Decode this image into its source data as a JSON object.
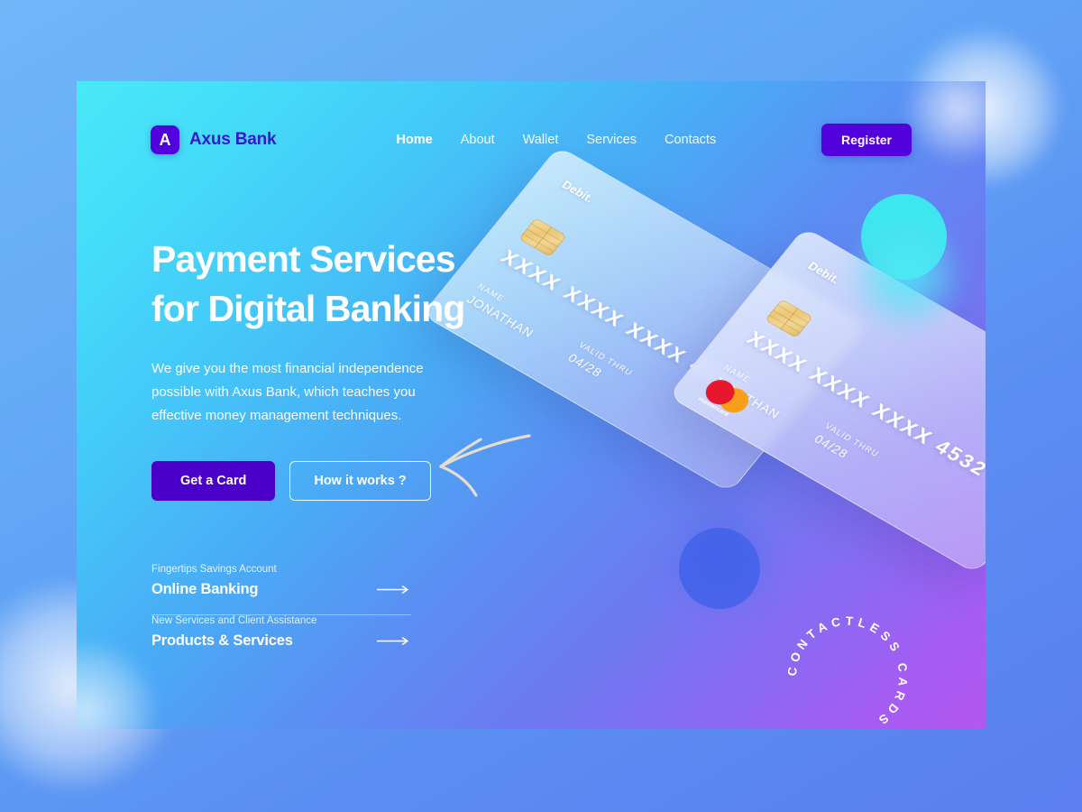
{
  "brand": {
    "logo_letter": "A",
    "name": "Axus Bank",
    "logo_color": "#5200dc",
    "name_color": "#3618cf"
  },
  "nav": {
    "items": [
      {
        "label": "Home",
        "active": true
      },
      {
        "label": "About",
        "active": false
      },
      {
        "label": "Wallet",
        "active": false
      },
      {
        "label": "Services",
        "active": false
      },
      {
        "label": "Contacts",
        "active": false
      }
    ],
    "register_label": "Register"
  },
  "hero": {
    "heading_line1": "Payment Services",
    "heading_line2": "for Digital Banking",
    "paragraph": "We give you the most financial independence possible with Axus Bank, which teaches you effective money management techniques.",
    "primary_cta": "Get a Card",
    "secondary_cta": "How it works ?"
  },
  "links": [
    {
      "kicker": "Fingertips Savings Account",
      "title": "Online Banking"
    },
    {
      "kicker": "New Services and Client Assistance",
      "title": "Products & Services"
    }
  ],
  "cards": [
    {
      "type_label": "Debit.",
      "number": "XXXX XXXX XXXX 4532",
      "name_label": "NAME",
      "name_value": "JONATHAN",
      "valid_label": "VALID THRU",
      "valid_value": "04/28",
      "network": ""
    },
    {
      "type_label": "Debit.",
      "number": "XXXX XXXX XXXX 4532",
      "name_label": "NAME",
      "name_value": "JONATHAN",
      "valid_label": "VALID THRU",
      "valid_value": "04/28",
      "network": "mastercard"
    }
  ],
  "badge": {
    "circular_text": "CONTACTLESS CARDS "
  },
  "theme": {
    "accent_purple": "#5200dc",
    "cta_purple": "#4a00c8",
    "panel_cyan": "#49e9f7",
    "panel_violet": "#b457f2",
    "outer_blue": "#62a8f6",
    "chip_gold": "#eac877",
    "mastercard_red": "#e8172e",
    "mastercard_yellow": "#f79f1a",
    "arrow_cream": "#e6ddd0"
  }
}
